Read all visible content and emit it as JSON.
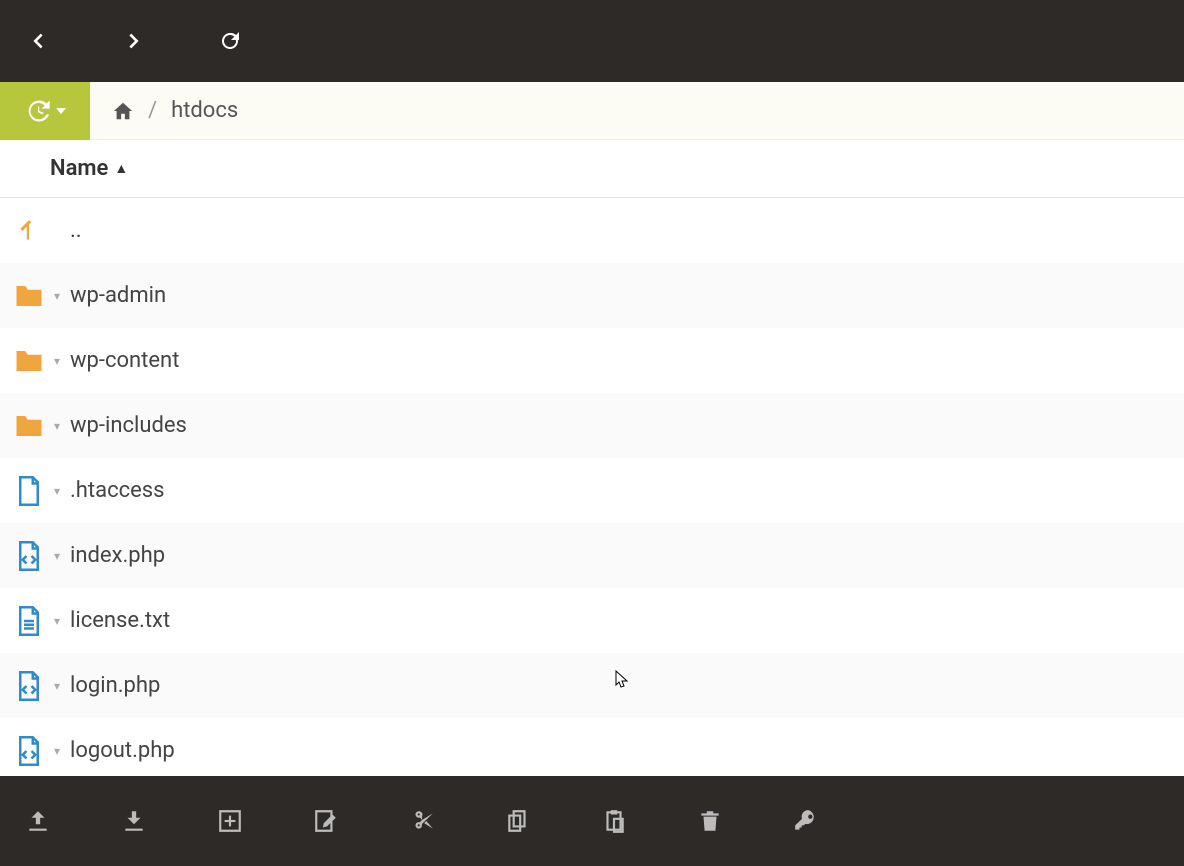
{
  "toolbar": {
    "back": "Back",
    "forward": "Forward",
    "refresh": "Refresh"
  },
  "history_button_label": "History",
  "breadcrumb": {
    "home_label": "Home",
    "items": [
      "htdocs"
    ]
  },
  "list": {
    "column_header": "Name",
    "sort_direction": "asc"
  },
  "entries": [
    {
      "type": "up",
      "name": ".."
    },
    {
      "type": "folder",
      "name": "wp-admin"
    },
    {
      "type": "folder",
      "name": "wp-content"
    },
    {
      "type": "folder",
      "name": "wp-includes"
    },
    {
      "type": "file",
      "name": ".htaccess"
    },
    {
      "type": "code",
      "name": "index.php"
    },
    {
      "type": "text",
      "name": "license.txt"
    },
    {
      "type": "code",
      "name": "login.php"
    },
    {
      "type": "code",
      "name": "logout.php"
    }
  ],
  "bottom_actions": {
    "upload": "Upload",
    "download": "Download",
    "new": "New",
    "edit": "Edit",
    "cut": "Cut",
    "copy": "Copy",
    "paste": "Paste",
    "delete": "Delete",
    "permissions": "Permissions"
  },
  "colors": {
    "accent": "#b6c63d",
    "folder": "#f0a63e",
    "file": "#2f8bcc",
    "toolbar_bg": "#2e2a27"
  }
}
